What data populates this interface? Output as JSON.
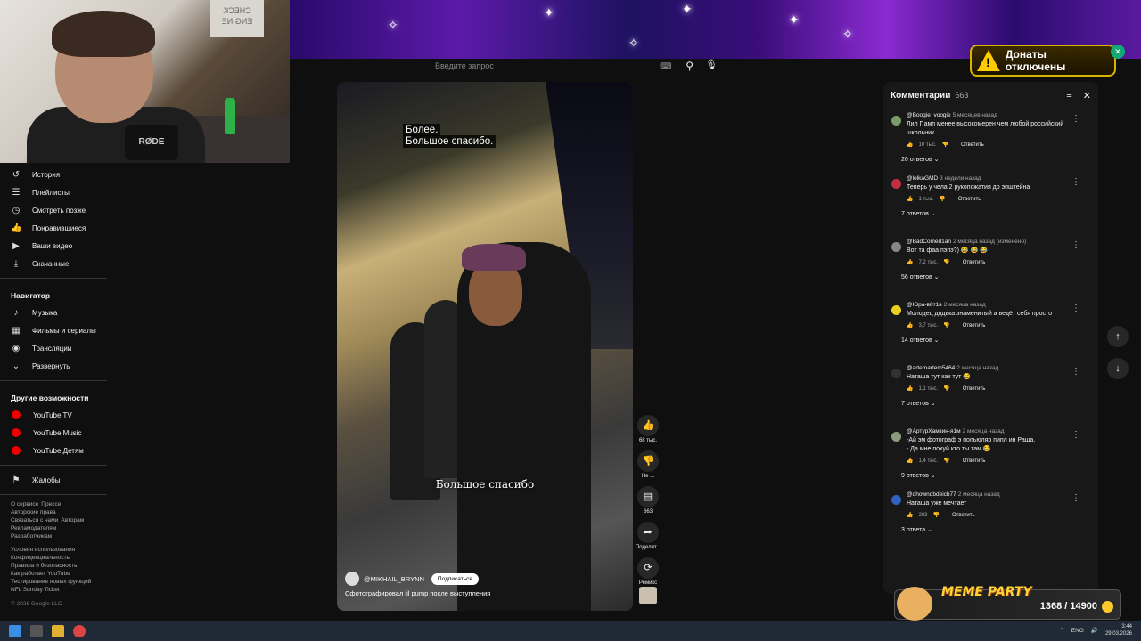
{
  "banner": {
    "donate_label": "Донаты отключены",
    "accent": "#d8b400"
  },
  "search": {
    "placeholder": "Введите запрос"
  },
  "webcam": {
    "sign_text": "CHECK ENGINE",
    "mic_text": "RØDE"
  },
  "sidebar": {
    "you_items": [
      {
        "icon": "history-icon",
        "label": "История"
      },
      {
        "icon": "playlist-icon",
        "label": "Плейлисты"
      },
      {
        "icon": "clock-icon",
        "label": "Смотреть позже"
      },
      {
        "icon": "like-icon",
        "label": "Понравившиеся"
      },
      {
        "icon": "video-icon",
        "label": "Ваши видео"
      },
      {
        "icon": "download-icon",
        "label": "Скачанные"
      }
    ],
    "navigator_heading": "Навигатор",
    "navigator_items": [
      {
        "icon": "music-icon",
        "label": "Музыка"
      },
      {
        "icon": "film-icon",
        "label": "Фильмы и сериалы"
      },
      {
        "icon": "live-icon",
        "label": "Трансляции"
      },
      {
        "icon": "chevron-down-icon",
        "label": "Развернуть"
      }
    ],
    "more_heading": "Другие возможности",
    "more_items": [
      {
        "label": "YouTube TV"
      },
      {
        "label": "YouTube Music"
      },
      {
        "label": "YouTube Детям"
      }
    ],
    "report_label": "Жалобы",
    "footer1": [
      "О сервисе",
      "Прессе",
      "Авторские права",
      "Связаться с нами",
      "Авторам",
      "Рекламодателям",
      "Разработчикам"
    ],
    "footer2": [
      "Условия использования",
      "Конфиденциальность",
      "Правила и безопасность",
      "Как работает YouTube",
      "Тестирование новых функций",
      "NFL Sunday Ticket"
    ],
    "copyright": "© 2026 Google LLC"
  },
  "video": {
    "caption_line1": "Более.",
    "caption_line2": "Большое спасибо.",
    "burned_subtitle": "Большое спасибо",
    "channel": "@MIKHAIL_BRYNN",
    "subscribe_label": "Подписаться",
    "title": "Сфотографировал lil pump после выступления"
  },
  "actions": {
    "likes": "68 тыс.",
    "dislike_label": "Не ...",
    "comments_count": "663",
    "share_label": "Поделит...",
    "remix_label": "Ремикс"
  },
  "comments": {
    "title": "Комментарии",
    "count": "663",
    "reply_label": "Ответить",
    "items": [
      {
        "author": "@Boogie_voogie",
        "time": "5 месяцев назад",
        "text": "Лил Памп менее высокомерен чем любой российский школьник.",
        "likes": "10 тыс.",
        "replies": "26 ответов",
        "color": "#7a9a6a"
      },
      {
        "author": "@lolkaGMD",
        "time": "3 недели назад",
        "text": "Теперь у чела 2 рукопожатия до эпштейна",
        "likes": "1 тыс.",
        "replies": "7 ответов",
        "color": "#c03040"
      },
      {
        "author": "@BadComed1an",
        "time": "2 месяца назад (изменено)",
        "text": "Вот та фаа пэпэ?) 😂 😂 😂",
        "likes": "7,2 тыс.",
        "replies": "56 ответов",
        "color": "#888888"
      },
      {
        "author": "@Юра-в8т1в",
        "time": "2 месяца назад",
        "text": "Молодец дядька,знаменитый а ведёт себя просто",
        "likes": "3,7 тыс.",
        "replies": "14 ответов",
        "color": "#e8d020"
      },
      {
        "author": "@artemartem5464",
        "time": "2 месяца назад",
        "text": "Наташа тут как тут 😂",
        "likes": "1,1 тыс.",
        "replies": "7 ответов",
        "color": "#333333"
      },
      {
        "author": "@АртурХамзин-я1м",
        "time": "2 месяца назад",
        "text": "-Ай эм фотограф э попьюляр пипл ин Раша.\n- Да мне похуй кто ты там 😂",
        "likes": "1,4 тыс.",
        "replies": "9 ответов",
        "color": "#8a9a7a"
      },
      {
        "author": "@dhowndbdeicb77",
        "time": "2 месяца назад",
        "text": "Наташа уже мечтает",
        "likes": "283",
        "replies": "3 ответа",
        "color": "#3060c0"
      }
    ]
  },
  "meme_party": {
    "title": "MEME PARTY",
    "score": "1368 / 14900"
  },
  "taskbar": {
    "lang": "ENG",
    "time": "3:44",
    "date": "29.03.2026"
  }
}
